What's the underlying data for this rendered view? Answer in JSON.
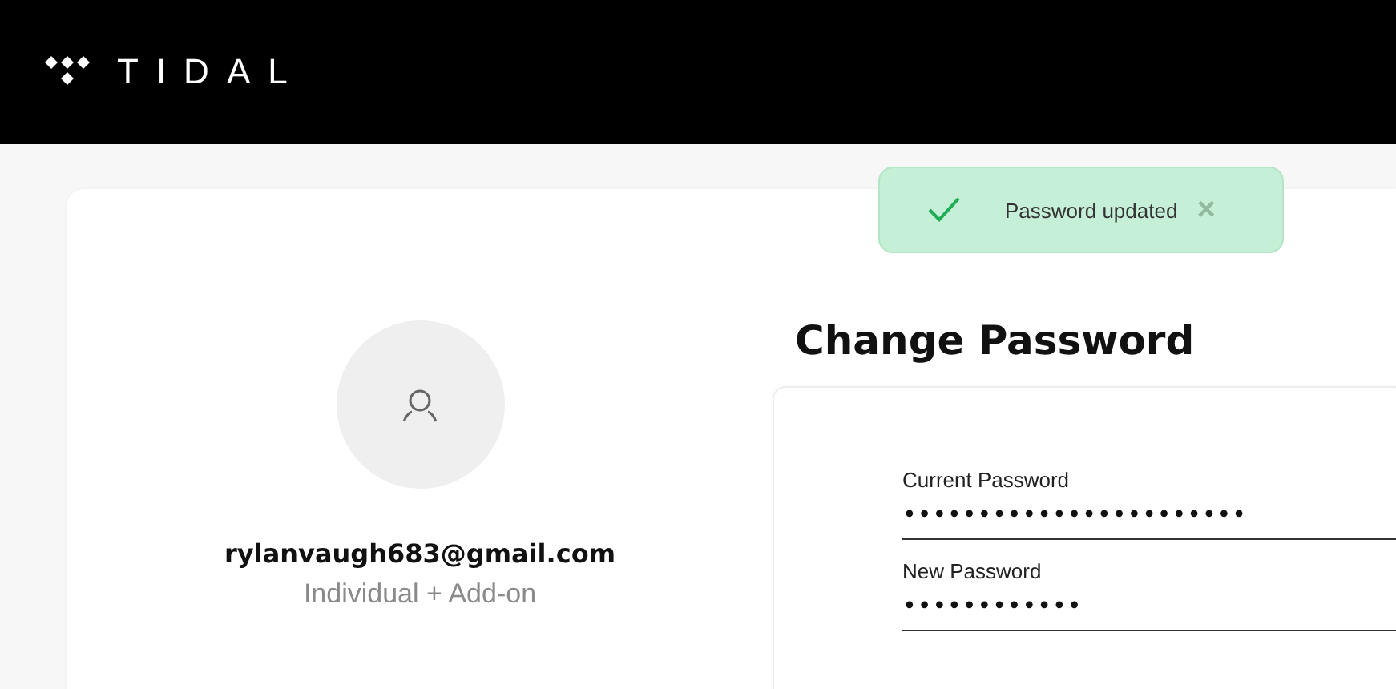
{
  "header": {
    "brand": "TIDAL"
  },
  "toast": {
    "message": "Password updated",
    "close": "×"
  },
  "profile": {
    "email": "rylanvaugh683@gmail.com",
    "plan": "Individual + Add-on"
  },
  "change_password": {
    "title": "Change Password",
    "fields": [
      {
        "label": "Current Password",
        "value": "•••••••••••••••••••••••"
      },
      {
        "label": "New Password",
        "value": "••••••••••••"
      }
    ]
  }
}
